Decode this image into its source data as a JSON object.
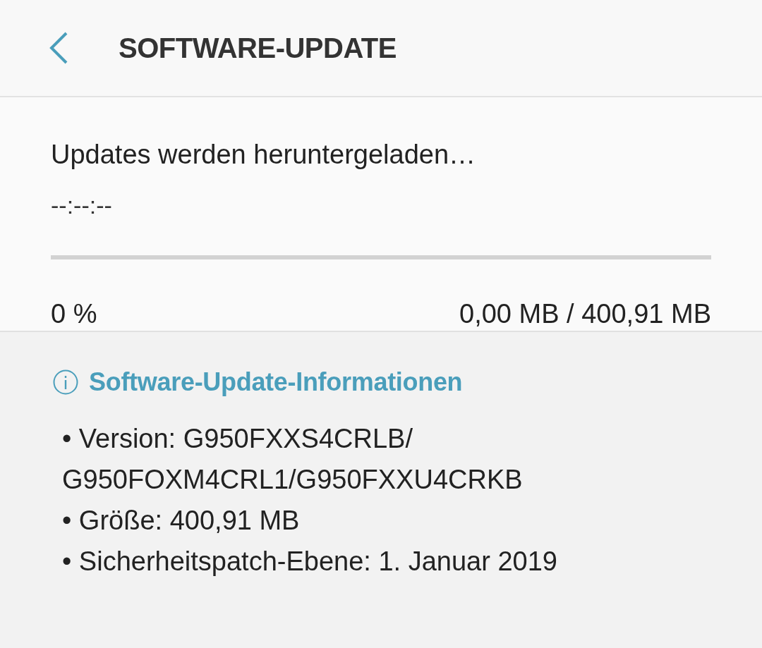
{
  "header": {
    "title": "SOFTWARE-UPDATE"
  },
  "download": {
    "status": "Updates werden heruntergeladen…",
    "time_remaining": "--:--:--",
    "progress": {
      "level": 0
    },
    "percent": "0 %",
    "size": "0,00 MB / 400,91 MB"
  },
  "info": {
    "heading": "Software-Update-Informationen",
    "items": [
      "• Version: G950FXXS4CRLB/ G950FOXM4CRL1/G950FXXU4CRKB",
      "• Größe: 400,91 MB",
      "• Sicherheitspatch-Ebene: 1. Januar 2019"
    ]
  }
}
